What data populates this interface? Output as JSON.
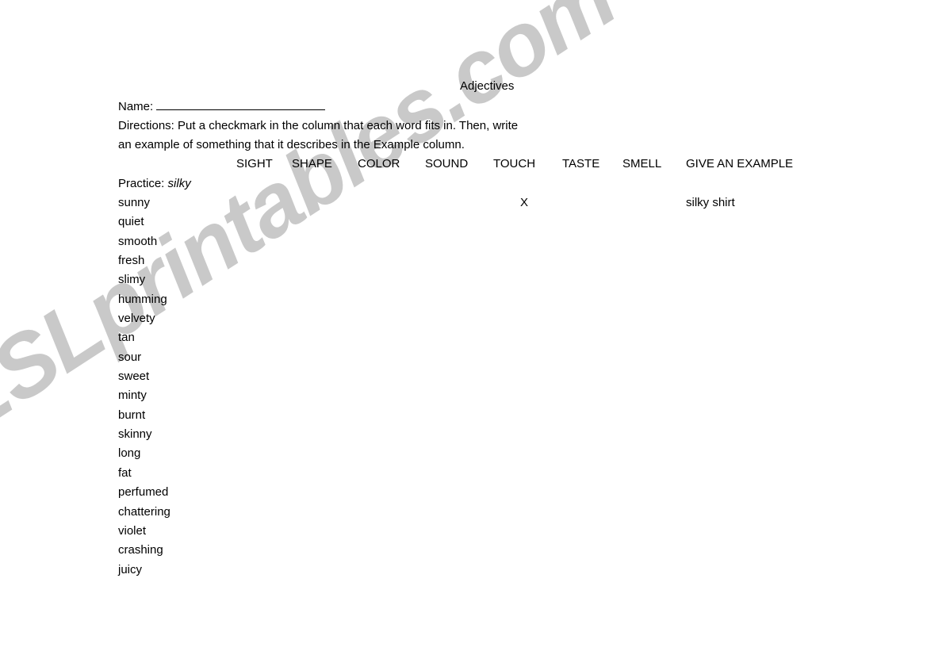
{
  "document": {
    "title": "Adjectives",
    "name_label": "Name:",
    "name_blank_value": "",
    "directions_line1": "Directions: Put a checkmark in the column that each word fits in.  Then, write",
    "directions_line2": "an example of something that it describes in the Example column."
  },
  "table": {
    "columns": [
      {
        "key": "sight",
        "label": "SIGHT"
      },
      {
        "key": "shape",
        "label": "SHAPE"
      },
      {
        "key": "color",
        "label": "COLOR"
      },
      {
        "key": "sound",
        "label": "SOUND"
      },
      {
        "key": "touch",
        "label": "TOUCH"
      },
      {
        "key": "taste",
        "label": "TASTE"
      },
      {
        "key": "smell",
        "label": "SMELL"
      },
      {
        "key": "example",
        "label": "GIVE AN EXAMPLE"
      }
    ],
    "practice": {
      "prefix": "Practice:",
      "word": "silky"
    },
    "rows": [
      {
        "word": "sunny",
        "mark_column": "touch",
        "mark": "X",
        "example": "silky shirt"
      },
      {
        "word": "quiet",
        "mark_column": "",
        "mark": "",
        "example": ""
      },
      {
        "word": "smooth",
        "mark_column": "",
        "mark": "",
        "example": ""
      },
      {
        "word": "fresh",
        "mark_column": "",
        "mark": "",
        "example": ""
      },
      {
        "word": "slimy",
        "mark_column": "",
        "mark": "",
        "example": ""
      },
      {
        "word": "humming",
        "mark_column": "",
        "mark": "",
        "example": ""
      },
      {
        "word": "velvety",
        "mark_column": "",
        "mark": "",
        "example": ""
      },
      {
        "word": "tan",
        "mark_column": "",
        "mark": "",
        "example": ""
      },
      {
        "word": "sour",
        "mark_column": "",
        "mark": "",
        "example": ""
      },
      {
        "word": "sweet",
        "mark_column": "",
        "mark": "",
        "example": ""
      },
      {
        "word": "minty",
        "mark_column": "",
        "mark": "",
        "example": ""
      },
      {
        "word": "burnt",
        "mark_column": "",
        "mark": "",
        "example": ""
      },
      {
        "word": "skinny",
        "mark_column": "",
        "mark": "",
        "example": ""
      },
      {
        "word": "long",
        "mark_column": "",
        "mark": "",
        "example": ""
      },
      {
        "word": "fat",
        "mark_column": "",
        "mark": "",
        "example": ""
      },
      {
        "word": "perfumed",
        "mark_column": "",
        "mark": "",
        "example": ""
      },
      {
        "word": "chattering",
        "mark_column": "",
        "mark": "",
        "example": ""
      },
      {
        "word": "violet",
        "mark_column": "",
        "mark": "",
        "example": ""
      },
      {
        "word": "crashing",
        "mark_column": "",
        "mark": "",
        "example": ""
      },
      {
        "word": "juicy",
        "mark_column": "",
        "mark": "",
        "example": ""
      }
    ]
  },
  "watermark": {
    "text": "ESLprintables.com",
    "color": "#c9c9c9"
  }
}
